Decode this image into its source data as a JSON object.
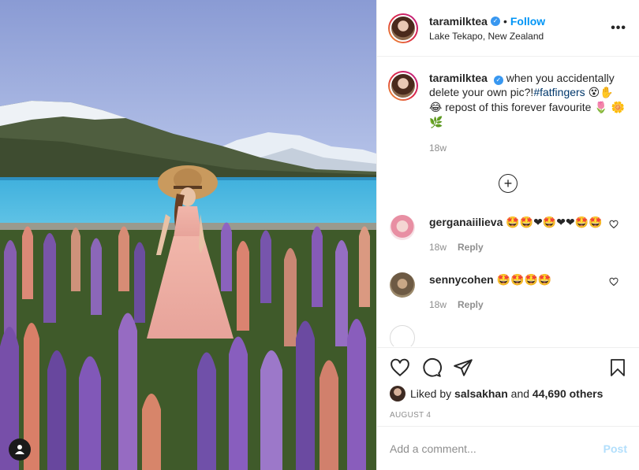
{
  "post": {
    "username": "taramilktea",
    "follow_label": "Follow",
    "separator": "•",
    "location": "Lake Tekapo, New Zealand",
    "more_label": "•••"
  },
  "caption": {
    "username": "taramilktea",
    "text_1": "when you accidentally delete your own pic?!",
    "hashtag": "#fatfingers",
    "emoji_1": "😵✋",
    "emoji_2": "😂",
    "text_2": "repost of this forever favourite",
    "emoji_3": "🌷",
    "emoji_4": "🌼🌿",
    "age": "18w"
  },
  "load_more_label": "+",
  "comments": [
    {
      "username": "gerganaiilieva",
      "emojis": "🤩🤩❤🤩❤❤🤩🤩",
      "age": "18w",
      "reply_label": "Reply"
    },
    {
      "username": "sennycohen",
      "emojis": "🤩🤩🤩🤩",
      "age": "18w",
      "reply_label": "Reply"
    }
  ],
  "likes": {
    "prefix": "Liked by",
    "liker": "salsakhan",
    "and": "and",
    "others": "44,690 others"
  },
  "date": "AUGUST 4",
  "comment_input": {
    "placeholder": "Add a comment...",
    "post_label": "Post"
  },
  "colors": {
    "link": "#0095f6",
    "hashtag": "#00376b",
    "muted": "#8e8e8e",
    "post_disabled": "#b2dffc"
  }
}
